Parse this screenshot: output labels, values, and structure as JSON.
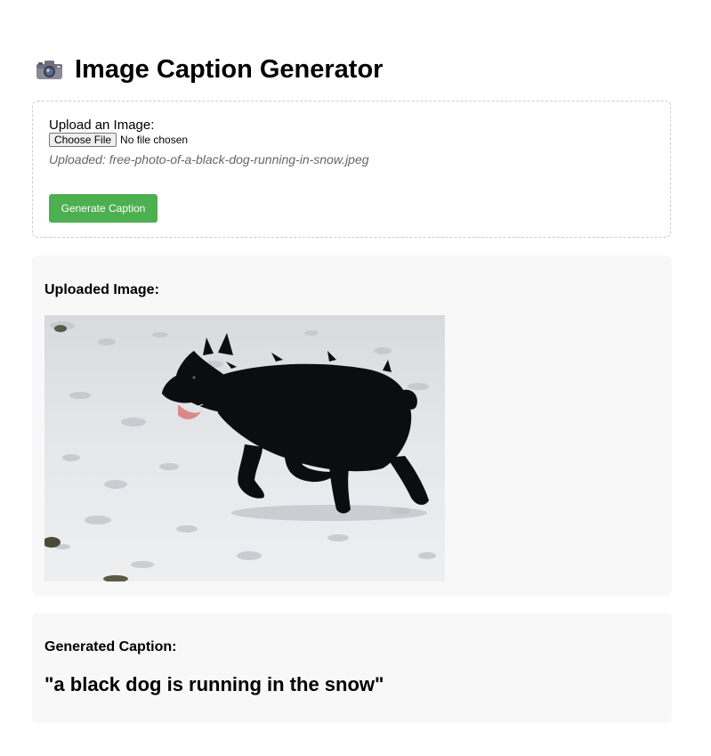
{
  "header": {
    "icon": "camera-icon",
    "title": "Image Caption Generator"
  },
  "upload": {
    "label": "Upload an Image:",
    "choose_button": "Choose File",
    "file_status": "No file chosen",
    "uploaded_note": "Uploaded: free-photo-of-a-black-dog-running-in-snow.jpeg",
    "generate_button": "Generate Caption",
    "accent_color": "#4caf50"
  },
  "image_section": {
    "heading": "Uploaded Image:",
    "image_subject": "black dog running in snow"
  },
  "caption_section": {
    "heading": "Generated Caption:",
    "caption": "\"a black dog is running in the snow\""
  }
}
